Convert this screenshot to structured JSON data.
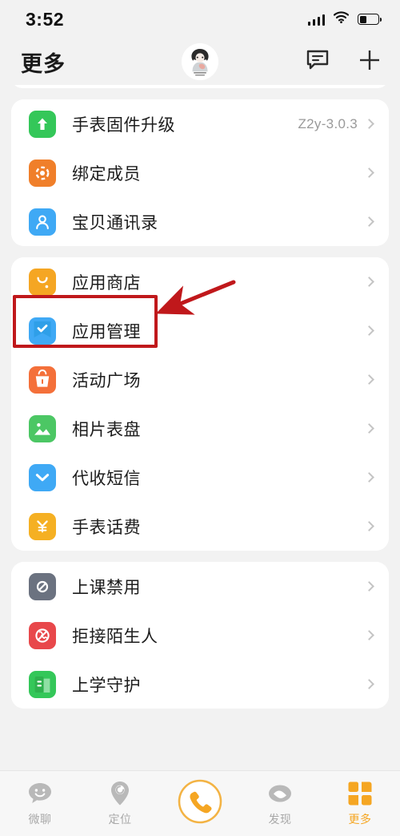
{
  "status_bar": {
    "time": "3:52",
    "signal_icon": "cellular-signal-icon",
    "wifi_icon": "wifi-icon",
    "battery_icon": "battery-icon"
  },
  "header": {
    "title": "更多",
    "avatar_name": "user-avatar",
    "message_icon": "message-bubble-icon",
    "add_icon": "plus-icon"
  },
  "cards": [
    {
      "name": "card-partial-top",
      "rows": []
    },
    {
      "name": "card-device",
      "rows": [
        {
          "label": "手表固件升级",
          "value": "Z2y-3.0.3",
          "icon": "upgrade-arrow-icon",
          "icon_color": "#34c759"
        },
        {
          "label": "绑定成员",
          "value": "",
          "icon": "bind-member-icon",
          "icon_color": "#f07f2a"
        },
        {
          "label": "宝贝通讯录",
          "value": "",
          "icon": "contacts-person-icon",
          "icon_color": "#3fa9f5"
        }
      ]
    },
    {
      "name": "card-apps",
      "rows": [
        {
          "label": "应用商店",
          "value": "",
          "icon": "app-store-bag-icon",
          "icon_color": "#f5a623",
          "highlighted": true
        },
        {
          "label": "应用管理",
          "value": "",
          "icon": "app-manage-check-icon",
          "icon_color": "#3fa9f5"
        },
        {
          "label": "活动广场",
          "value": "",
          "icon": "activity-bucket-icon",
          "icon_color": "#f4703a"
        },
        {
          "label": "相片表盘",
          "value": "",
          "icon": "photo-watchface-icon",
          "icon_color": "#4cc764"
        },
        {
          "label": "代收短信",
          "value": "",
          "icon": "sms-envelope-icon",
          "icon_color": "#3fa9f5"
        },
        {
          "label": "手表话费",
          "value": "",
          "icon": "watch-balance-yuan-icon",
          "icon_color": "#f5b023"
        }
      ]
    },
    {
      "name": "card-restrictions",
      "rows": [
        {
          "label": "上课禁用",
          "value": "",
          "icon": "class-disable-icon",
          "icon_color": "#6b7280"
        },
        {
          "label": "拒接陌生人",
          "value": "",
          "icon": "reject-stranger-icon",
          "icon_color": "#e8484b"
        },
        {
          "label": "上学守护",
          "value": "",
          "icon": "school-guard-book-icon",
          "icon_color": "#34c759"
        }
      ]
    }
  ],
  "tabbar": {
    "items": [
      {
        "label": "微聊",
        "icon": "chat-smiley-icon",
        "active": false
      },
      {
        "label": "定位",
        "icon": "location-pin-icon",
        "active": false
      },
      {
        "label": "",
        "icon": "phone-call-icon",
        "active": false
      },
      {
        "label": "发现",
        "icon": "discover-eye-icon",
        "active": false
      },
      {
        "label": "更多",
        "icon": "more-grid-icon",
        "active": true
      }
    ]
  },
  "annotation": {
    "box_color": "#c0181b",
    "arrow_color": "#c0181b",
    "target": "应用商店"
  }
}
